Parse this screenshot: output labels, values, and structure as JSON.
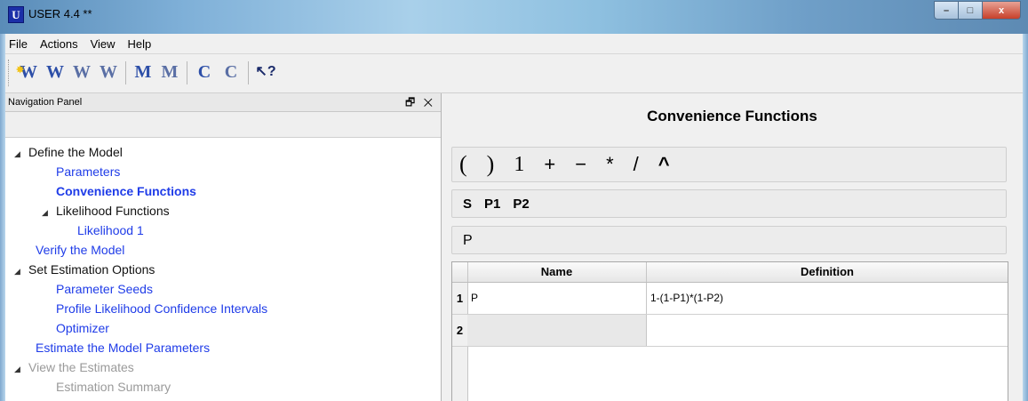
{
  "window": {
    "title": "USER 4.4 **",
    "app_icon": "U"
  },
  "window_controls": {
    "minimize": "–",
    "maximize": "□",
    "close": "x"
  },
  "menubar": {
    "items": [
      "File",
      "Actions",
      "View",
      "Help"
    ]
  },
  "toolbar": {
    "buttons": [
      {
        "icon": "new-workspace-icon",
        "glyph": "W"
      },
      {
        "icon": "open-workspace-icon",
        "glyph": "W"
      },
      {
        "icon": "workspace-3-icon",
        "glyph": "W"
      },
      {
        "icon": "workspace-4-icon",
        "glyph": "W"
      },
      {
        "icon": "model-icon",
        "glyph": "M"
      },
      {
        "icon": "model-2-icon",
        "glyph": "M"
      },
      {
        "icon": "c-icon",
        "glyph": "C"
      },
      {
        "icon": "c-2-icon",
        "glyph": "C"
      },
      {
        "icon": "whats-this-icon",
        "glyph": "↖?"
      }
    ]
  },
  "nav_panel": {
    "title": "Navigation Panel",
    "controls": "🗗 ✕",
    "tree": [
      {
        "label": "Define the Model",
        "level": 0,
        "expandable": true,
        "style": "black"
      },
      {
        "label": "Parameters",
        "level": 1,
        "style": "blue"
      },
      {
        "label": "Convenience Functions",
        "level": 1,
        "style": "bold"
      },
      {
        "label": "Likelihood Functions",
        "level": 1,
        "expandable": true,
        "style": "black"
      },
      {
        "label": "Likelihood 1",
        "level": 2,
        "style": "blue"
      },
      {
        "label": "Verify the Model",
        "level": 0,
        "style": "blue"
      },
      {
        "label": "Set Estimation Options",
        "level": 0,
        "expandable": true,
        "style": "black"
      },
      {
        "label": "Parameter Seeds",
        "level": 1,
        "style": "blue"
      },
      {
        "label": "Profile Likelihood Confidence Intervals",
        "level": 1,
        "style": "blue"
      },
      {
        "label": "Optimizer",
        "level": 1,
        "style": "blue"
      },
      {
        "label": "Estimate the Model Parameters",
        "level": 0,
        "style": "blue"
      },
      {
        "label": "View the Estimates",
        "level": 0,
        "expandable": true,
        "style": "gray"
      },
      {
        "label": "Estimation Summary",
        "level": 1,
        "style": "gray"
      }
    ]
  },
  "content": {
    "title": "Convenience Functions",
    "operators": [
      "(",
      ")",
      "1",
      "+",
      "−",
      "*",
      "/",
      "^"
    ],
    "variables": [
      "S",
      "P1",
      "P2"
    ],
    "expression": "P",
    "table": {
      "columns": [
        "Name",
        "Definition"
      ],
      "rows": [
        {
          "num": "1",
          "name": "P",
          "definition": "1-(1-P1)*(1-P2)"
        },
        {
          "num": "2",
          "name": "",
          "definition": ""
        }
      ]
    }
  },
  "colors": {
    "link_blue": "#1f3ce8",
    "disabled_gray": "#9a9a9a",
    "title_bar": "#7fb0d8"
  }
}
